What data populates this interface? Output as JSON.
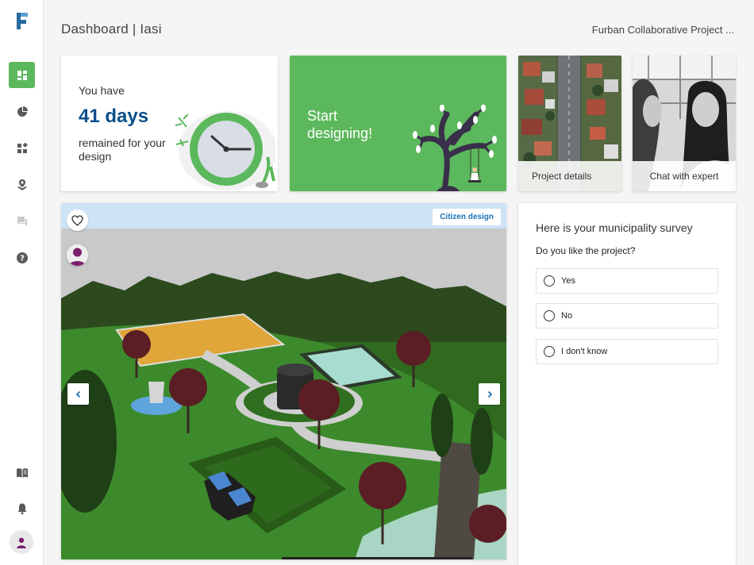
{
  "header": {
    "title": "Dashboard | Iasi",
    "project": "Furban Collaborative Project ..."
  },
  "sidebar": {
    "items": [
      {
        "name": "dashboard",
        "icon": "dashboard-icon",
        "active": true
      },
      {
        "name": "statistics",
        "icon": "pie-chart-icon",
        "active": false
      },
      {
        "name": "widgets",
        "icon": "widgets-icon",
        "active": false
      },
      {
        "name": "map",
        "icon": "map-pin-icon",
        "active": false
      },
      {
        "name": "chat",
        "icon": "chat-icon",
        "active": false
      },
      {
        "name": "help",
        "icon": "help-icon",
        "active": false
      },
      {
        "name": "guide",
        "icon": "book-icon",
        "active": false
      },
      {
        "name": "notifications",
        "icon": "bell-icon",
        "active": false
      }
    ]
  },
  "countdown": {
    "prefix": "You have",
    "days": "41 days",
    "suffix": "remained for your design"
  },
  "start": {
    "label": "Start designing!"
  },
  "tiles": {
    "details": "Project details",
    "chat": "Chat with expert"
  },
  "viewer": {
    "badge": "Citizen design"
  },
  "survey": {
    "heading": "Here is your municipality survey",
    "question": "Do you like the project?",
    "options": [
      "Yes",
      "No",
      "I don't know"
    ]
  },
  "colors": {
    "accent": "#5cb85c",
    "days": "#0b4f8a",
    "badge": "#1a73b8"
  }
}
